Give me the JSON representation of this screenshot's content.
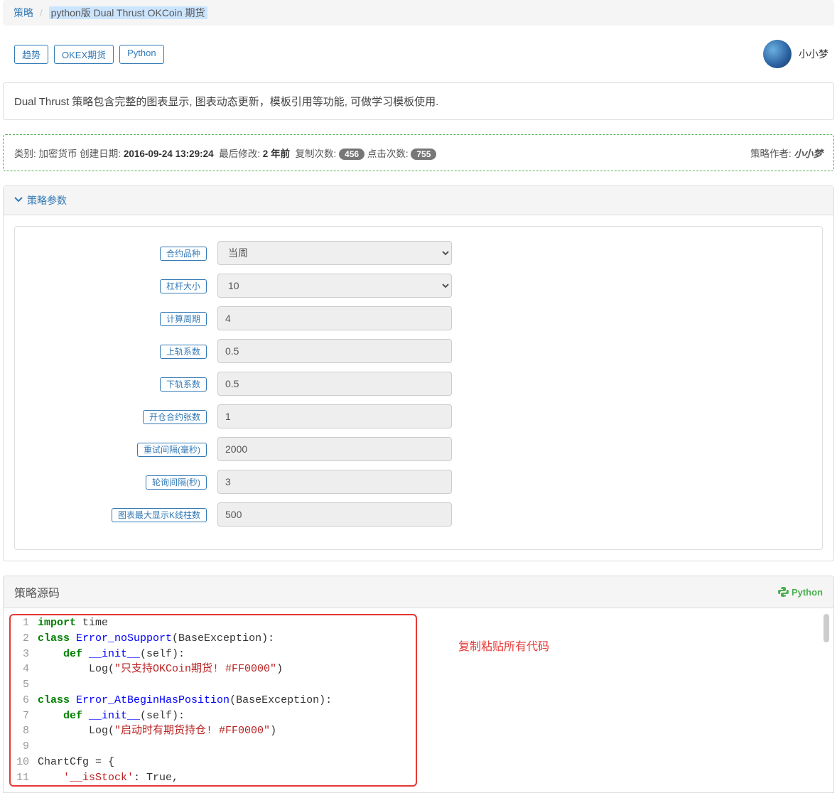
{
  "breadcrumb": {
    "root": "策略",
    "current": "python版 Dual Thrust OKCoin 期货"
  },
  "tags": [
    "趋势",
    "OKEX期货",
    "Python"
  ],
  "author": {
    "name": "小小梦"
  },
  "description": "Dual Thrust 策略包含完整的图表显示, 图表动态更新，模板引用等功能, 可做学习模板使用.",
  "meta": {
    "category_label": "类别:",
    "category": "加密货币",
    "created_label": "创建日期:",
    "created": "2016-09-24 13:29:24",
    "modified_label": "最后修改:",
    "modified": "2 年前",
    "copy_label": "复制次数:",
    "copy_count": "456",
    "click_label": "点击次数:",
    "click_count": "755",
    "author_label": "策略作者:",
    "author": "小小梦"
  },
  "sections": {
    "params_title": "策略参数",
    "source_title": "策略源码",
    "source_lang": "Python"
  },
  "params": {
    "contract_type": {
      "label": "合约品种",
      "value": "当周"
    },
    "leverage": {
      "label": "杠杆大小",
      "value": "10"
    },
    "period": {
      "label": "计算周期",
      "value": "4"
    },
    "upper_coef": {
      "label": "上轨系数",
      "value": "0.5"
    },
    "lower_coef": {
      "label": "下轨系数",
      "value": "0.5"
    },
    "open_contracts": {
      "label": "开仓合约张数",
      "value": "1"
    },
    "retry_ms": {
      "label": "重试间隔(毫秒)",
      "value": "2000"
    },
    "poll_s": {
      "label": "轮询间隔(秒)",
      "value": "3"
    },
    "max_kline": {
      "label": "图表最大显示K线柱数",
      "value": "500"
    }
  },
  "annotation": "复制粘贴所有代码",
  "code": {
    "l1_kw": "import",
    "l1_rest": " time",
    "l2_kw": "class",
    "l2_cls": " Error_noSupport",
    "l2_rest": "(BaseException):",
    "l3_kw": "    def",
    "l3_fn": " __init__",
    "l3_rest": "(self):",
    "l4_pre": "        Log(",
    "l4_str": "\"只支持OKCoin期货! #FF0000\"",
    "l4_post": ")",
    "l6_kw": "class",
    "l6_cls": " Error_AtBeginHasPosition",
    "l6_rest": "(BaseException):",
    "l7_kw": "    def",
    "l7_fn": " __init__",
    "l7_rest": "(self):",
    "l8_pre": "        Log(",
    "l8_str": "\"启动时有期货持仓! #FF0000\"",
    "l8_post": ")",
    "l10": "ChartCfg = {",
    "l11_pre": "    ",
    "l11_str": "'__isStock'",
    "l11_post": ": True,"
  }
}
